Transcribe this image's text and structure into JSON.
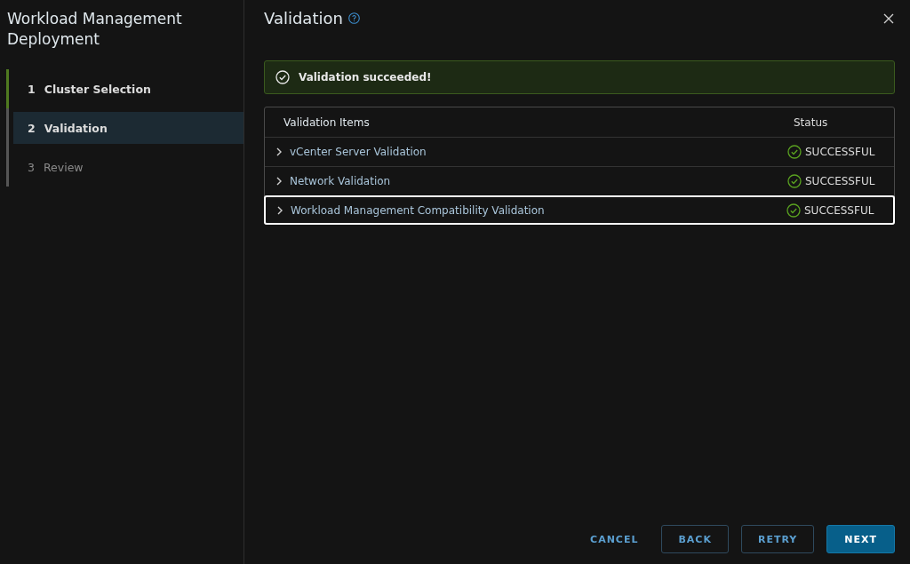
{
  "sidebar": {
    "title": "Workload Management Deployment",
    "steps": [
      {
        "number": "1",
        "label": "Cluster Selection",
        "completed": true,
        "selected": false,
        "disabled": false
      },
      {
        "number": "2",
        "label": "Validation",
        "completed": false,
        "selected": true,
        "disabled": false
      },
      {
        "number": "3",
        "label": "Review",
        "completed": false,
        "selected": false,
        "disabled": true
      }
    ]
  },
  "main": {
    "title": "Validation",
    "alert": {
      "kind": "success",
      "text": "Validation succeeded!"
    },
    "table": {
      "columns": [
        "Validation Items",
        "Status"
      ],
      "rows": [
        {
          "item": "vCenter Server Validation",
          "status": "SUCCESSFUL",
          "kind": "success",
          "focused": false
        },
        {
          "item": "Network Validation",
          "status": "SUCCESSFUL",
          "kind": "success",
          "focused": false
        },
        {
          "item": "Workload Management Compatibility Validation",
          "status": "SUCCESSFUL",
          "kind": "success",
          "focused": true
        }
      ]
    },
    "buttons": [
      {
        "label": "CANCEL",
        "kind": "link"
      },
      {
        "label": "BACK",
        "kind": "outline"
      },
      {
        "label": "RETRY",
        "kind": "outline"
      },
      {
        "label": "NEXT",
        "kind": "primary"
      }
    ]
  }
}
